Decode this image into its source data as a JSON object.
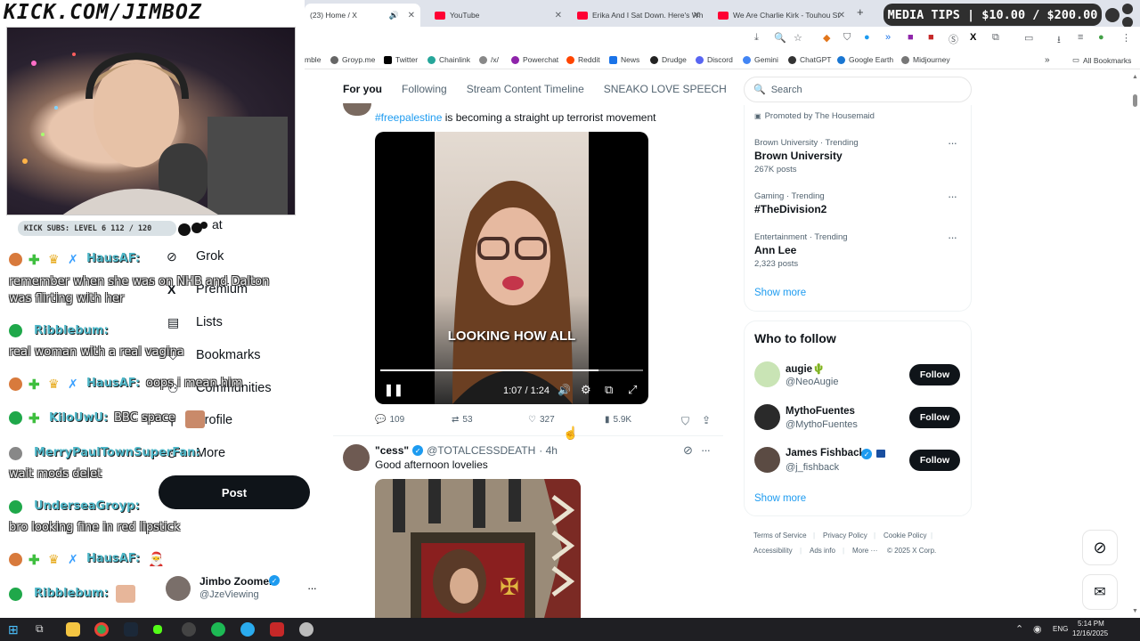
{
  "stream": {
    "banner": "KICK.COM/JIMBOZ",
    "subs_bar": "KICK SUBS: LEVEL 6 112 / 120",
    "media_tips": "MEDIA TIPS | $10.00 / $200.00"
  },
  "browser": {
    "tabs": [
      {
        "label": "(23) Home / X",
        "active": true
      },
      {
        "label": "YouTube",
        "active": false
      },
      {
        "label": "Erika And I Sat Down. Here's Wh",
        "active": false
      },
      {
        "label": "We Are Charlie Kirk - Touhou St",
        "active": false
      }
    ],
    "bookmarks": [
      "mble",
      "Groyp.me",
      "Twitter",
      "Chainlink",
      "/x/",
      "Powerchat",
      "Reddit",
      "News",
      "Drudge",
      "Discord",
      "Gemini",
      "ChatGPT",
      "Google Earth",
      "Midjourney"
    ],
    "all_bookmarks": "All Bookmarks"
  },
  "feed": {
    "tabs": [
      "For you",
      "Following",
      "Stream Content Timeline",
      "SNEAKO LOVE SPEECH"
    ],
    "post1": {
      "hashtag": "#freepalestine",
      "text": " is becoming a straight up terrorist movement",
      "video_caption": "LOOKING HOW ALL",
      "video_time": "1:07 / 1:24",
      "progress": 0.83,
      "replies": "109",
      "reposts": "53",
      "likes": "327",
      "views": "5.9K"
    },
    "post2": {
      "name": "\"cess\"",
      "handle": "@TOTALCESSDEATH",
      "time": "· 4h",
      "text": "Good afternoon lovelies"
    }
  },
  "leftnav": {
    "items": [
      "Grok",
      "Premium",
      "Lists",
      "Bookmarks",
      "Communities",
      "Profile",
      "More"
    ],
    "partial_top": "at",
    "post_button": "Post",
    "account_name": "Jimbo Zoomer",
    "account_handle": "@JzeViewing"
  },
  "chat": [
    {
      "user": "HausAF:",
      "msg": "remember when she was on NHB and Dalton was flirting with her"
    },
    {
      "user": "Ribblebum:",
      "msg": "real woman with a real vagina"
    },
    {
      "user": "HausAF:",
      "msg": "oops i mean him"
    },
    {
      "user": "KiloUwU:",
      "msg": "BBC space"
    },
    {
      "user": "MerryPaulTownSuperFan:",
      "msg": "wait mods delet"
    },
    {
      "user": "UnderseaGroyp:",
      "msg": "bro looking fine in red lipstick"
    },
    {
      "user": "HausAF:",
      "msg": ""
    },
    {
      "user": "Ribblebum:",
      "msg": ""
    }
  ],
  "sidebar": {
    "search_placeholder": "Search",
    "promoted": "Promoted by The Housemaid",
    "trends": [
      {
        "category": "Brown University · Trending",
        "name": "Brown University",
        "count": "267K posts"
      },
      {
        "category": "Gaming · Trending",
        "name": "#TheDivision2",
        "count": ""
      },
      {
        "category": "Entertainment · Trending",
        "name": "Ann Lee",
        "count": "2,323 posts"
      }
    ],
    "show_more": "Show more",
    "who_to_follow": "Who to follow",
    "follow_label": "Follow",
    "suggestions": [
      {
        "name": "augie🌵",
        "handle": "@NeoAugie"
      },
      {
        "name": "MythoFuentes",
        "handle": "@MythoFuentes"
      },
      {
        "name": "James Fishback",
        "handle": "@j_fishback"
      }
    ],
    "footer": [
      "Terms of Service",
      "Privacy Policy",
      "Cookie Policy",
      "Accessibility",
      "Ads info",
      "More ···",
      "© 2025 X Corp."
    ]
  },
  "taskbar": {
    "lang": "ENG",
    "time": "5:14 PM",
    "date": "12/16/2025"
  },
  "colors": {
    "accent": "#1d9bf0",
    "follow_bg": "#0f1419",
    "chat_name": "#4fb7c8"
  }
}
